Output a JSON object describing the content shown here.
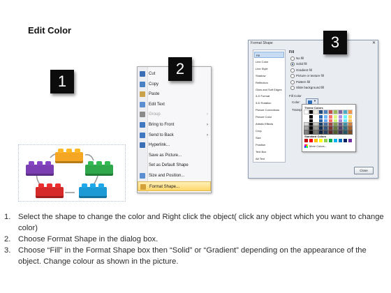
{
  "title": "Edit Color",
  "steps": {
    "one": "1",
    "two": "2",
    "three": "3"
  },
  "lego_colors": {
    "orange": "#f5a623",
    "purple": "#7b3fb3",
    "green": "#2ea84a",
    "red": "#d62a2a",
    "blue": "#1c9ad6"
  },
  "context_menu": {
    "items": [
      {
        "label": "Cut",
        "icon": "scissors-icon",
        "disabled": false,
        "submenu": false,
        "highlighted": false
      },
      {
        "label": "Copy",
        "icon": "copy-icon",
        "disabled": false,
        "submenu": false,
        "highlighted": false
      },
      {
        "label": "Paste",
        "icon": "paste-icon",
        "disabled": false,
        "submenu": false,
        "highlighted": false
      },
      {
        "label": "Edit Text",
        "icon": "edit-text-icon",
        "disabled": false,
        "submenu": false,
        "highlighted": false
      },
      {
        "label": "Group",
        "icon": "group-icon",
        "disabled": true,
        "submenu": true,
        "highlighted": false
      },
      {
        "label": "Bring to Front",
        "icon": "bring-front-icon",
        "disabled": false,
        "submenu": true,
        "highlighted": false
      },
      {
        "label": "Send to Back",
        "icon": "send-back-icon",
        "disabled": false,
        "submenu": true,
        "highlighted": false
      },
      {
        "label": "Hyperlink...",
        "icon": "hyperlink-icon",
        "disabled": false,
        "submenu": false,
        "highlighted": false
      },
      {
        "label": "Save as Picture...",
        "icon": "",
        "disabled": false,
        "submenu": false,
        "highlighted": false
      },
      {
        "label": "Set as Default Shape",
        "icon": "",
        "disabled": false,
        "submenu": false,
        "highlighted": false
      },
      {
        "label": "Size and Position...",
        "icon": "size-position-icon",
        "disabled": false,
        "submenu": false,
        "highlighted": false
      },
      {
        "label": "Format Shape...",
        "icon": "format-shape-icon",
        "disabled": false,
        "submenu": false,
        "highlighted": true
      }
    ]
  },
  "format_dialog": {
    "title": "Format Shape",
    "close_glyph": "✕",
    "left_items": [
      "Fill",
      "Line Color",
      "Line Style",
      "Shadow",
      "Reflection",
      "Glow and Soft Edges",
      "3-D Format",
      "3-D Rotation",
      "Picture Corrections",
      "Picture Color",
      "Artistic Effects",
      "Crop",
      "Size",
      "Position",
      "Text Box",
      "Alt Text"
    ],
    "selected_left": "Fill",
    "fill_heading": "Fill",
    "options": [
      "No fill",
      "Solid fill",
      "Gradient fill",
      "Picture or texture fill",
      "Pattern fill",
      "Slide background fill"
    ],
    "selected_option": "Solid fill",
    "fill_color_label": "Fill Color",
    "color_label": "Color:",
    "transparency_label": "Transpa",
    "theme_colors_label": "Theme Colors",
    "standard_colors_label": "Standard Colors",
    "more_colors_label": "More Colors...",
    "close_label": "Close"
  },
  "instructions": [
    {
      "num": "1.",
      "text": "Select the shape to change the color and Right click the object( click any object which you want to change color)"
    },
    {
      "num": "2.",
      "text": "Choose Format Shape in the dialog box."
    },
    {
      "num": "3.",
      "text": "Choose “Fill” in the Format Shape box then “Solid” or “Gradient” depending on the appearance of the object. Change colour as shown in the picture."
    }
  ]
}
